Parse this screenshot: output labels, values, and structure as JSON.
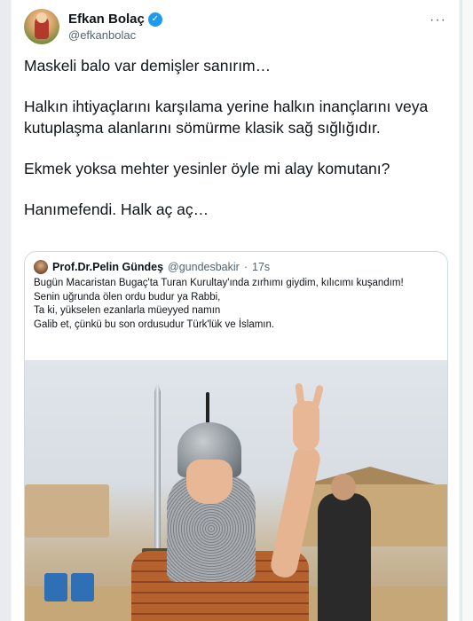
{
  "author": {
    "display_name": "Efkan Bolaç",
    "handle": "@efkanbolac",
    "verified": true,
    "avatar_icon": "profile-photo"
  },
  "tweet": {
    "paragraphs": [
      "Maskeli balo var demişler sanırım…",
      "Halkın ihtiyaçlarını karşılama yerine halkın inançlarını veya kutuplaşma alanlarını sömürme klasik sağ sığlığıdır.",
      "Ekmek yoksa mehter yesinler öyle mi alay komutanı?",
      "Hanımefendi. Halk aç aç…"
    ]
  },
  "quoted_tweet": {
    "display_name": "Prof.Dr.Pelin Gündeş",
    "handle": "@gundesbakir",
    "separator": "·",
    "time": "17s",
    "lines": [
      "Bugün Macaristan Bugaç'ta Turan Kurultay'ında zırhımı giydim, kılıcımı kuşandım!",
      "Senin uğrunda ölen ordu budur ya Rabbi,",
      "Ta ki, yükselen ezanlarla müeyyed namın",
      "Galib et, çünkü bu son ordusudur Türk'lük ve İslamın."
    ]
  },
  "colors": {
    "accent": "#1d9bf0",
    "text": "#0f1419",
    "secondary": "#536471",
    "border": "#cfd9de"
  }
}
